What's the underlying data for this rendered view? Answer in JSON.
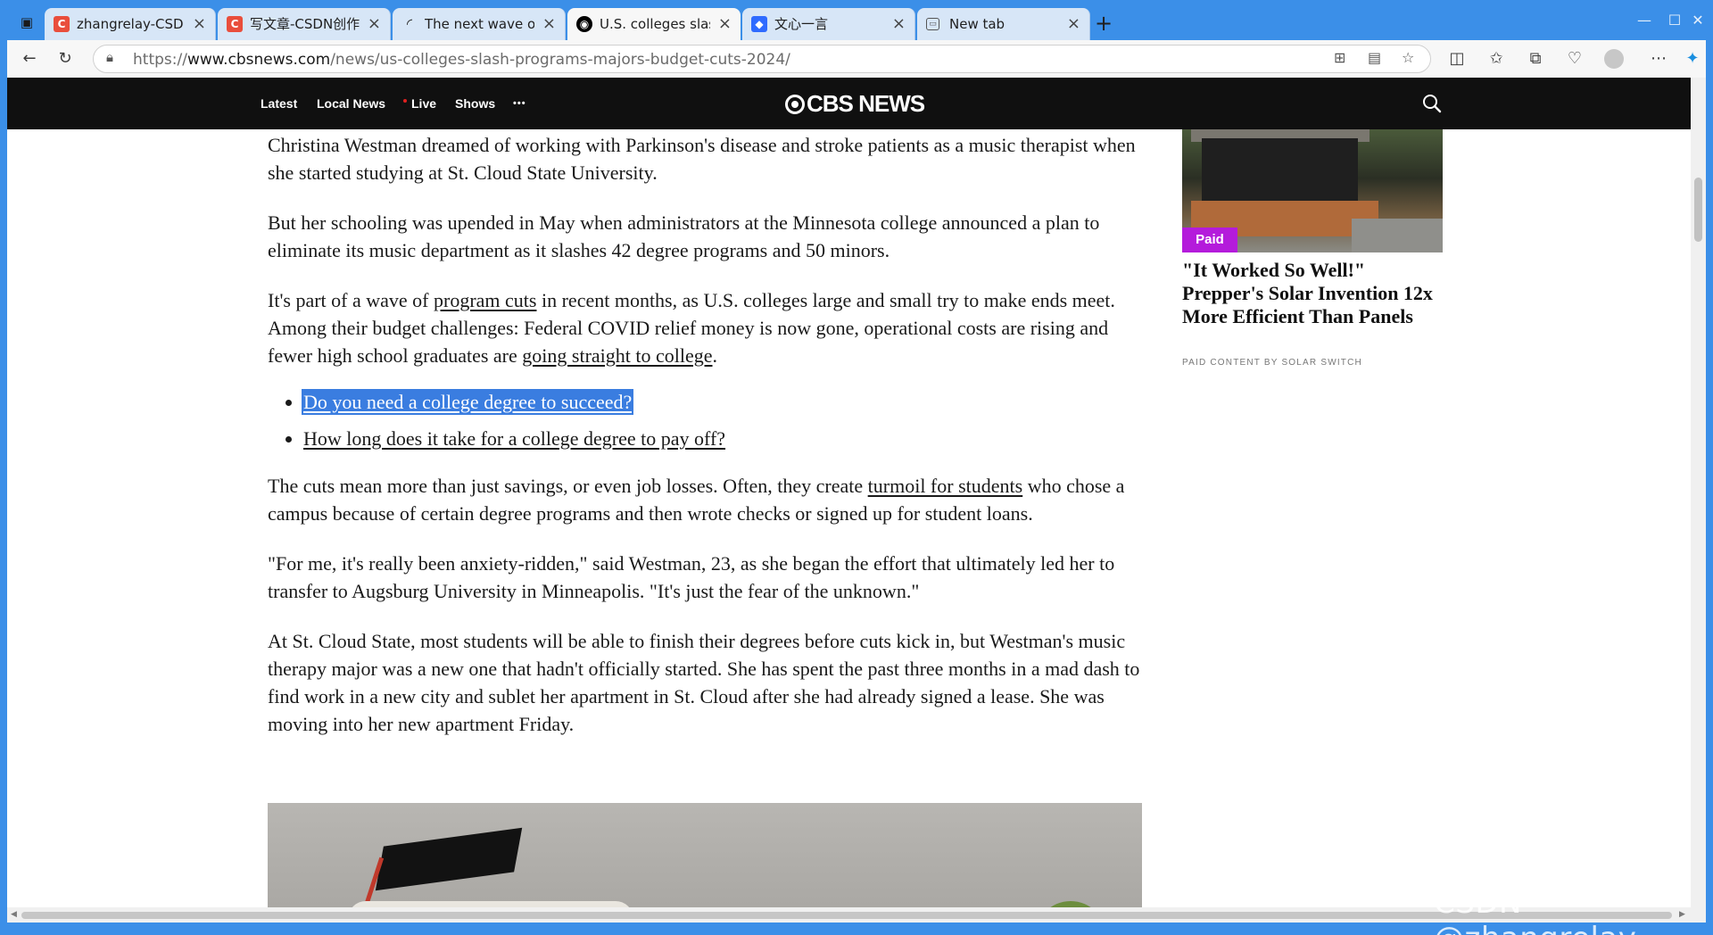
{
  "browser": {
    "tabs": [
      {
        "title": "zhangrelay-CSDN博客",
        "favicon": "C",
        "favicon_color": "#e94e3c"
      },
      {
        "title": "写文章-CSDN创作中心",
        "favicon": "C",
        "favicon_color": "#e94e3c"
      },
      {
        "title": "The next wave of college c",
        "favicon": "loading-icon",
        "favicon_color": "#2a2a2a"
      },
      {
        "title": "U.S. colleges slash majors (",
        "favicon": "cbs-icon",
        "favicon_color": "#000000",
        "active": true
      },
      {
        "title": "文心一言",
        "favicon": "wenxin-icon",
        "favicon_color": "#2f6bff"
      },
      {
        "title": "New tab",
        "favicon": "newtab-icon",
        "favicon_color": "#555555"
      }
    ],
    "close_glyph": "×",
    "newtab_glyph": "+",
    "url_prefix": "https://",
    "url_host": "www.cbsnews.com",
    "url_path": "/news/us-colleges-slash-programs-majors-budget-cuts-2024/"
  },
  "site": {
    "nav": [
      "Latest",
      "Local News",
      "Live",
      "Shows"
    ],
    "more": "•••",
    "brand": "CBS NEWS"
  },
  "article": {
    "p1": "Christina Westman dreamed of working with Parkinson's disease and stroke patients as a music therapist when she started studying at St. Cloud State University.",
    "p2": "But her schooling was upended in May when administrators at the Minnesota college announced a plan to eliminate its music department as it slashes 42 degree programs and 50 minors.",
    "p3_a": "It's part of a wave of ",
    "p3_link1": "program cuts",
    "p3_b": " in recent months, as U.S. colleges large and small try to make ends meet. Among their budget challenges: Federal COVID relief money is now gone, operational costs are rising and fewer high school graduates are ",
    "p3_link2": "going straight to college",
    "p3_c": ".",
    "related": [
      "Do you need a college degree to succeed?",
      "How long does it take for a college degree to pay off?"
    ],
    "p4_a": "The cuts mean more than just savings, or even job losses. Often, they create ",
    "p4_link": "turmoil for students",
    "p4_b": " who chose a campus because of certain degree programs and then wrote checks or signed up for student loans.",
    "p5": "\"For me, it's really been anxiety-ridden,\" said Westman, 23, as she began the effort that ultimately led her to transfer to Augsburg University in Minneapolis. \"It's just the fear of the unknown.\"",
    "p6": "At St. Cloud State, most students will be able to finish their degrees before cuts kick in, but Westman's music therapy major was a new one that hadn't officially started. She has spent the past three months in a mad dash to find work in a new city and sublet her apartment in St. Cloud after she had already signed a lease. She was moving into her new apartment Friday."
  },
  "ad": {
    "badge": "Paid",
    "headline": "\"It Worked So Well!\" Prepper's Solar Invention 12x More Efficient Than Panels",
    "sponsor": "PAID CONTENT BY SOLAR SWITCH",
    "badge_color": "#b41bdb"
  },
  "watermark": "CSDN @zhangrelay"
}
